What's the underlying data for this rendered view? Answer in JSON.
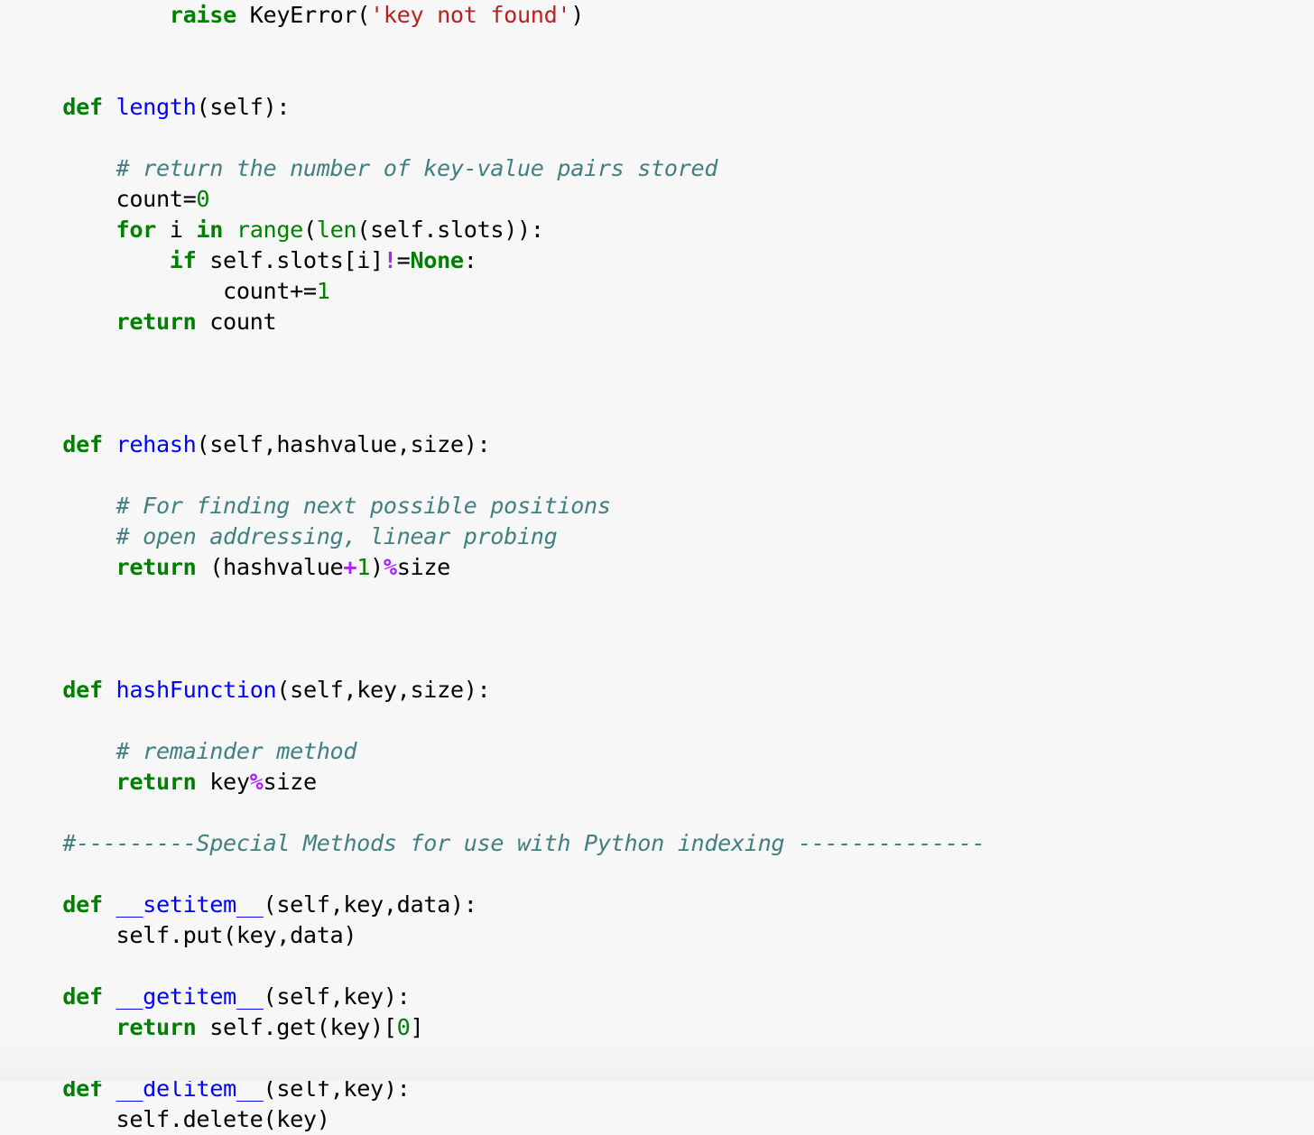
{
  "document": {
    "kind": "python-source-listing",
    "background_color": "#f7f7f7",
    "language": "Python",
    "colors": {
      "keyword": "#008000",
      "function_name": "#0000ff",
      "builtin": "#008000",
      "string": "#ba2121",
      "comment": "#408080",
      "number": "#008000",
      "operator": "#aa22ff",
      "plain_text": "#000000"
    }
  },
  "code": {
    "lines": [
      {
        "id": "line-raise-keyerror",
        "indent": 12,
        "text": "raise KeyError('key not found')",
        "tokens": [
          {
            "t": "raise",
            "c": "k"
          },
          {
            "t": " ",
            "c": "p"
          },
          {
            "t": "KeyError",
            "c": "ne"
          },
          {
            "t": "(",
            "c": "p"
          },
          {
            "t": "'key not found'",
            "c": "s"
          },
          {
            "t": ")",
            "c": "p"
          }
        ]
      },
      {
        "id": "line-blank-1",
        "indent": 0,
        "text": "",
        "tokens": []
      },
      {
        "id": "line-blank-2",
        "indent": 0,
        "text": "",
        "tokens": []
      },
      {
        "id": "line-def-length",
        "indent": 4,
        "text": "def length(self):",
        "tokens": [
          {
            "t": "def",
            "c": "k"
          },
          {
            "t": " ",
            "c": "p"
          },
          {
            "t": "length",
            "c": "nf"
          },
          {
            "t": "(self):",
            "c": "p"
          }
        ]
      },
      {
        "id": "line-blank-3",
        "indent": 0,
        "text": "",
        "tokens": []
      },
      {
        "id": "line-comment-count-pairs",
        "indent": 8,
        "text": "# return the number of key-value pairs stored",
        "tokens": [
          {
            "t": "# return the number of key-value pairs stored",
            "c": "c"
          }
        ]
      },
      {
        "id": "line-count-init",
        "indent": 8,
        "text": "count=0",
        "tokens": [
          {
            "t": "count=",
            "c": "n"
          },
          {
            "t": "0",
            "c": "mi"
          }
        ]
      },
      {
        "id": "line-for-range",
        "indent": 8,
        "text": "for i in range(len(self.slots)):",
        "tokens": [
          {
            "t": "for",
            "c": "k"
          },
          {
            "t": " i ",
            "c": "n"
          },
          {
            "t": "in",
            "c": "k"
          },
          {
            "t": " ",
            "c": "p"
          },
          {
            "t": "range",
            "c": "nb"
          },
          {
            "t": "(",
            "c": "p"
          },
          {
            "t": "len",
            "c": "nb"
          },
          {
            "t": "(self.slots)):",
            "c": "p"
          }
        ]
      },
      {
        "id": "line-if-slot-not-none",
        "indent": 12,
        "text": "if self.slots[i]!=None:",
        "tokens": [
          {
            "t": "if",
            "c": "k"
          },
          {
            "t": " self.slots[i]",
            "c": "n"
          },
          {
            "t": "!",
            "c": "o"
          },
          {
            "t": "=",
            "c": "p"
          },
          {
            "t": "None",
            "c": "kc"
          },
          {
            "t": ":",
            "c": "p"
          }
        ]
      },
      {
        "id": "line-count-increment",
        "indent": 16,
        "text": "count+=1",
        "tokens": [
          {
            "t": "count+=",
            "c": "n"
          },
          {
            "t": "1",
            "c": "mi"
          }
        ]
      },
      {
        "id": "line-return-count",
        "indent": 8,
        "text": "return count",
        "tokens": [
          {
            "t": "return",
            "c": "k"
          },
          {
            "t": " count",
            "c": "n"
          }
        ]
      },
      {
        "id": "line-blank-4",
        "indent": 0,
        "text": "",
        "tokens": []
      },
      {
        "id": "line-blank-5",
        "indent": 0,
        "text": "",
        "tokens": []
      },
      {
        "id": "line-blank-6",
        "indent": 0,
        "text": "",
        "tokens": []
      },
      {
        "id": "line-def-rehash",
        "indent": 4,
        "text": "def rehash(self,hashvalue,size):",
        "tokens": [
          {
            "t": "def",
            "c": "k"
          },
          {
            "t": " ",
            "c": "p"
          },
          {
            "t": "rehash",
            "c": "nf"
          },
          {
            "t": "(self,hashvalue,size):",
            "c": "p"
          }
        ]
      },
      {
        "id": "line-blank-7",
        "indent": 0,
        "text": "",
        "tokens": []
      },
      {
        "id": "line-comment-next-positions",
        "indent": 8,
        "text": "# For finding next possible positions",
        "tokens": [
          {
            "t": "# For finding next possible positions",
            "c": "c"
          }
        ]
      },
      {
        "id": "line-comment-linear-probing",
        "indent": 8,
        "text": "# open addressing, linear probing",
        "tokens": [
          {
            "t": "# open addressing, linear probing",
            "c": "c"
          }
        ]
      },
      {
        "id": "line-return-rehash",
        "indent": 8,
        "text": "return (hashvalue+1)%size",
        "tokens": [
          {
            "t": "return",
            "c": "k"
          },
          {
            "t": " (hashvalue",
            "c": "n"
          },
          {
            "t": "+",
            "c": "o"
          },
          {
            "t": "1",
            "c": "mi"
          },
          {
            "t": ")",
            "c": "p"
          },
          {
            "t": "%",
            "c": "o"
          },
          {
            "t": "size",
            "c": "n"
          }
        ]
      },
      {
        "id": "line-blank-8",
        "indent": 0,
        "text": "",
        "tokens": []
      },
      {
        "id": "line-blank-9",
        "indent": 0,
        "text": "",
        "tokens": []
      },
      {
        "id": "line-blank-10",
        "indent": 0,
        "text": "",
        "tokens": []
      },
      {
        "id": "line-def-hashfunction",
        "indent": 4,
        "text": "def hashFunction(self,key,size):",
        "tokens": [
          {
            "t": "def",
            "c": "k"
          },
          {
            "t": " ",
            "c": "p"
          },
          {
            "t": "hashFunction",
            "c": "nf"
          },
          {
            "t": "(self,key,size):",
            "c": "p"
          }
        ]
      },
      {
        "id": "line-blank-11",
        "indent": 0,
        "text": "",
        "tokens": []
      },
      {
        "id": "line-comment-remainder-method",
        "indent": 8,
        "text": "# remainder method",
        "tokens": [
          {
            "t": "# remainder method",
            "c": "c"
          }
        ]
      },
      {
        "id": "line-return-key-mod-size",
        "indent": 8,
        "text": "return key%size",
        "tokens": [
          {
            "t": "return",
            "c": "k"
          },
          {
            "t": " key",
            "c": "n"
          },
          {
            "t": "%",
            "c": "o"
          },
          {
            "t": "size",
            "c": "n"
          }
        ]
      },
      {
        "id": "line-blank-12",
        "indent": 0,
        "text": "",
        "tokens": []
      },
      {
        "id": "line-comment-special-methods-banner",
        "indent": 4,
        "text": "#---------Special Methods for use with Python indexing --------------",
        "tokens": [
          {
            "t": "#---------Special Methods for use with Python indexing --------------",
            "c": "c"
          }
        ]
      },
      {
        "id": "line-blank-13",
        "indent": 0,
        "text": "",
        "tokens": []
      },
      {
        "id": "line-def-setitem",
        "indent": 4,
        "text": "def __setitem__(self,key,data):",
        "tokens": [
          {
            "t": "def",
            "c": "k"
          },
          {
            "t": " ",
            "c": "p"
          },
          {
            "t": "__setitem__",
            "c": "nf"
          },
          {
            "t": "(self,key,data):",
            "c": "p"
          }
        ]
      },
      {
        "id": "line-self-put",
        "indent": 8,
        "text": "self.put(key,data)",
        "tokens": [
          {
            "t": "self.put(key,data)",
            "c": "n"
          }
        ]
      },
      {
        "id": "line-blank-14",
        "indent": 0,
        "text": "",
        "tokens": []
      },
      {
        "id": "line-def-getitem",
        "indent": 4,
        "text": "def __getitem__(self,key):",
        "tokens": [
          {
            "t": "def",
            "c": "k"
          },
          {
            "t": " ",
            "c": "p"
          },
          {
            "t": "__getitem__",
            "c": "nf"
          },
          {
            "t": "(self,key):",
            "c": "p"
          }
        ]
      },
      {
        "id": "line-return-self-get",
        "indent": 8,
        "text": "return self.get(key)[0]",
        "tokens": [
          {
            "t": "return",
            "c": "k"
          },
          {
            "t": " self.get(key)[",
            "c": "n"
          },
          {
            "t": "0",
            "c": "mi"
          },
          {
            "t": "]",
            "c": "p"
          }
        ]
      },
      {
        "id": "line-blank-15",
        "indent": 0,
        "text": "",
        "tokens": []
      },
      {
        "id": "line-def-delitem",
        "indent": 4,
        "text": "def __delitem__(self,key):",
        "tokens": [
          {
            "t": "def",
            "c": "k"
          },
          {
            "t": " ",
            "c": "p"
          },
          {
            "t": "__delitem__",
            "c": "nf"
          },
          {
            "t": "(self,key):",
            "c": "p"
          }
        ]
      },
      {
        "id": "line-self-delete",
        "indent": 8,
        "text": "self.delete(key)",
        "tokens": [
          {
            "t": "self.delete(key)",
            "c": "n"
          }
        ]
      }
    ]
  }
}
